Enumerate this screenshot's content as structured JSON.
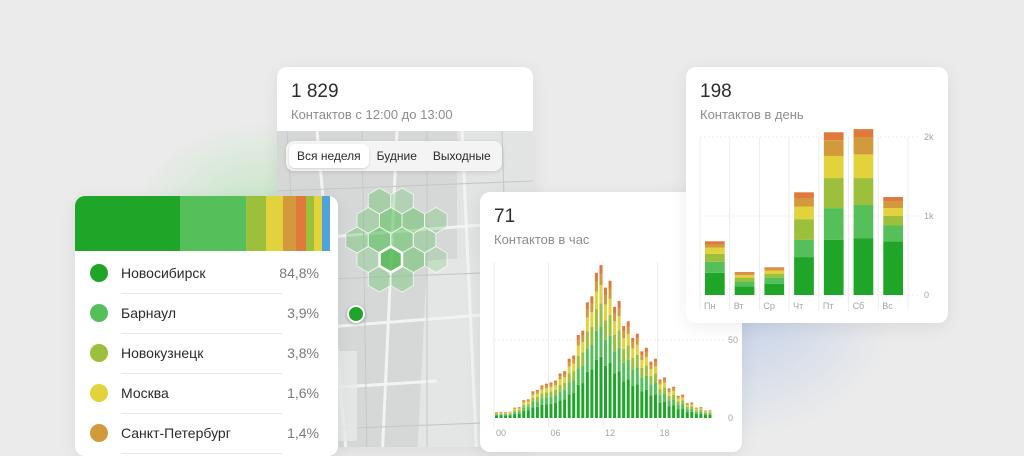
{
  "map_card": {
    "value": "1 829",
    "caption": "Контактов с 12:00 до 13:00",
    "tabs": [
      {
        "label": "Вся неделя",
        "active": true
      },
      {
        "label": "Будние",
        "active": false
      },
      {
        "label": "Выходные",
        "active": false
      }
    ]
  },
  "cities": {
    "items": [
      {
        "name": "Новосибирск",
        "share": "84,8%",
        "color": "#1fa628"
      },
      {
        "name": "Барнаул",
        "share": "3,9%",
        "color": "#55bf5a"
      },
      {
        "name": "Новокузнецк",
        "share": "3,8%",
        "color": "#9cbf3c"
      },
      {
        "name": "Москва",
        "share": "1,6%",
        "color": "#e2d23c"
      },
      {
        "name": "Санкт-Петербург",
        "share": "1,4%",
        "color": "#d29a3c"
      }
    ],
    "strip": [
      {
        "share": 0.4,
        "color": "#1fa628"
      },
      {
        "share": 0.25,
        "color": "#55bf5a"
      },
      {
        "share": 0.075,
        "color": "#9cbf3c"
      },
      {
        "share": 0.065,
        "color": "#e2d23c"
      },
      {
        "share": 0.05,
        "color": "#d29a3c"
      },
      {
        "share": 0.04,
        "color": "#e07a3c"
      },
      {
        "share": 0.03,
        "color": "#9cbf3c"
      },
      {
        "share": 0.03,
        "color": "#e2d23c"
      },
      {
        "share": 0.03,
        "color": "#4fa3d9"
      }
    ]
  },
  "hour_card": {
    "value": "71",
    "caption": "Контактов в час"
  },
  "day_card": {
    "value": "198",
    "caption": "Контактов в день"
  },
  "colors": {
    "seg1": "#1fa628",
    "seg2": "#55bf5a",
    "seg3": "#9cbf3c",
    "seg4": "#e2d23c",
    "seg5": "#d29a3c",
    "seg6": "#e07a3c"
  },
  "chart_data": [
    {
      "type": "bar",
      "stacked": true,
      "title": "Контактов в час",
      "x": [
        0,
        1,
        2,
        3,
        4,
        5,
        6,
        7,
        8,
        9,
        10,
        11,
        12,
        13,
        14,
        15,
        16,
        17,
        18,
        19,
        20,
        21,
        22,
        23
      ],
      "x_tick_labels": [
        "00",
        "06",
        "12",
        "18"
      ],
      "y_tick_labels": [
        "0",
        "50"
      ],
      "ylim": [
        0,
        100
      ],
      "totals": [
        4,
        4,
        7,
        12,
        18,
        22,
        24,
        30,
        40,
        56,
        78,
        98,
        88,
        75,
        62,
        54,
        45,
        38,
        26,
        20,
        15,
        10,
        7,
        5
      ],
      "grid": true
    },
    {
      "type": "bar",
      "stacked": true,
      "title": "Контактов в день",
      "categories": [
        "Пн",
        "Вт",
        "Ср",
        "Чт",
        "Пт",
        "Сб",
        "Вс"
      ],
      "y_tick_labels": [
        "0",
        "1k",
        "2k"
      ],
      "ylim": [
        0,
        2000
      ],
      "series": [
        {
          "values": [
            280,
            110,
            140,
            480,
            700,
            720,
            680
          ]
        },
        {
          "values": [
            140,
            60,
            80,
            220,
            400,
            420,
            200
          ]
        },
        {
          "values": [
            100,
            50,
            50,
            260,
            380,
            340,
            120
          ]
        },
        {
          "values": [
            80,
            30,
            40,
            160,
            280,
            300,
            100
          ]
        },
        {
          "values": [
            40,
            20,
            20,
            100,
            200,
            220,
            80
          ]
        },
        {
          "values": [
            40,
            20,
            20,
            80,
            100,
            100,
            60
          ]
        }
      ],
      "grid": true
    }
  ]
}
